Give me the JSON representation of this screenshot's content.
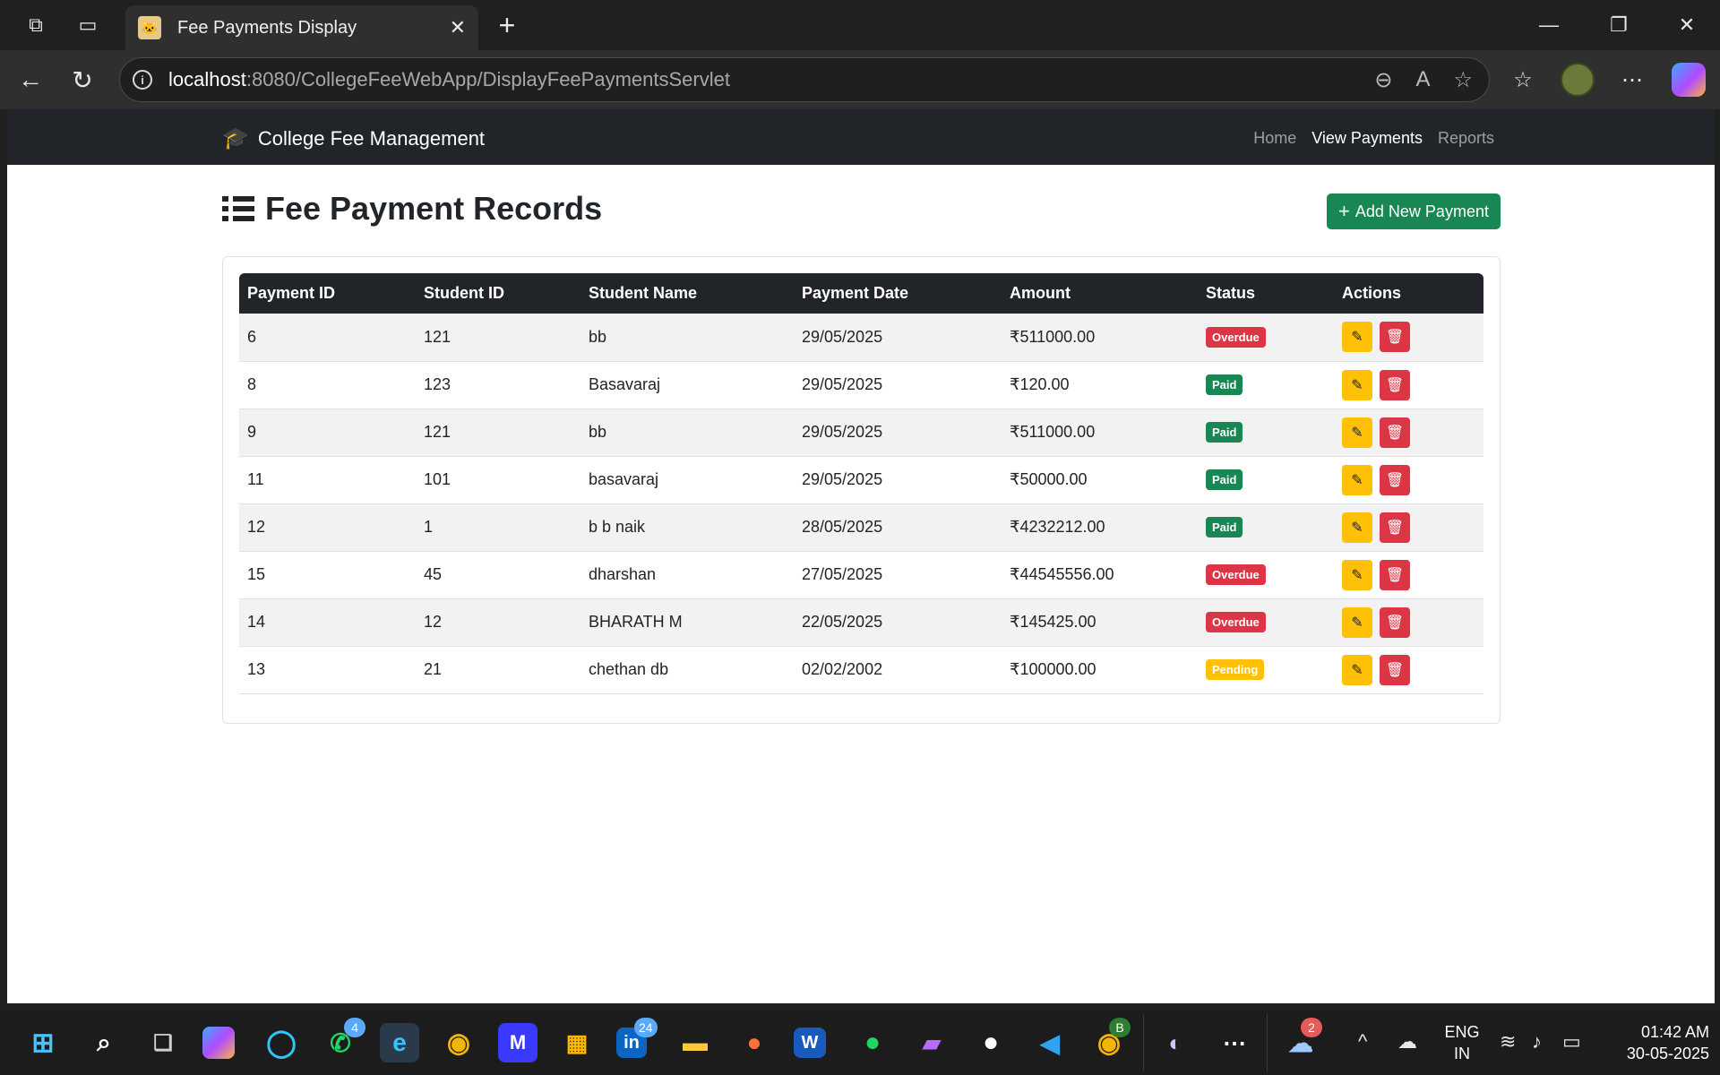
{
  "browser": {
    "tab_title": "Fee Payments Display",
    "url_host": "localhost",
    "url_rest": ":8080/CollegeFeeWebApp/DisplayFeePaymentsServlet"
  },
  "navbar": {
    "brand": "College Fee Management",
    "links": [
      {
        "label": "Home",
        "active": false
      },
      {
        "label": "View Payments",
        "active": true
      },
      {
        "label": "Reports",
        "active": false
      }
    ]
  },
  "page": {
    "title": "Fee Payment Records",
    "add_button": "Add New Payment"
  },
  "table": {
    "headers": [
      "Payment ID",
      "Student ID",
      "Student Name",
      "Payment Date",
      "Amount",
      "Status",
      "Actions"
    ],
    "rows": [
      {
        "payment_id": "6",
        "student_id": "121",
        "name": "bb",
        "date": "29/05/2025",
        "amount": "₹511000.00",
        "status": "Overdue"
      },
      {
        "payment_id": "8",
        "student_id": "123",
        "name": "Basavaraj",
        "date": "29/05/2025",
        "amount": "₹120.00",
        "status": "Paid"
      },
      {
        "payment_id": "9",
        "student_id": "121",
        "name": "bb",
        "date": "29/05/2025",
        "amount": "₹511000.00",
        "status": "Paid"
      },
      {
        "payment_id": "11",
        "student_id": "101",
        "name": "basavaraj",
        "date": "29/05/2025",
        "amount": "₹50000.00",
        "status": "Paid"
      },
      {
        "payment_id": "12",
        "student_id": "1",
        "name": "b b naik",
        "date": "28/05/2025",
        "amount": "₹4232212.00",
        "status": "Paid"
      },
      {
        "payment_id": "15",
        "student_id": "45",
        "name": "dharshan",
        "date": "27/05/2025",
        "amount": "₹44545556.00",
        "status": "Overdue"
      },
      {
        "payment_id": "14",
        "student_id": "12",
        "name": "BHARATH M",
        "date": "22/05/2025",
        "amount": "₹145425.00",
        "status": "Overdue"
      },
      {
        "payment_id": "13",
        "student_id": "21",
        "name": "chethan db",
        "date": "02/02/2002",
        "amount": "₹100000.00",
        "status": "Pending"
      }
    ]
  },
  "colors": {
    "navbar_bg": "#212529",
    "success": "#198754",
    "danger": "#dc3545",
    "warning": "#ffc107"
  },
  "taskbar": {
    "whatsapp_badge": "4",
    "linkedin_badge": "24",
    "chrome_profile_badge": "B",
    "weather_badge": "2",
    "language_line1": "ENG",
    "language_line2": "IN",
    "time": "01:42 AM",
    "date": "30-05-2025"
  }
}
